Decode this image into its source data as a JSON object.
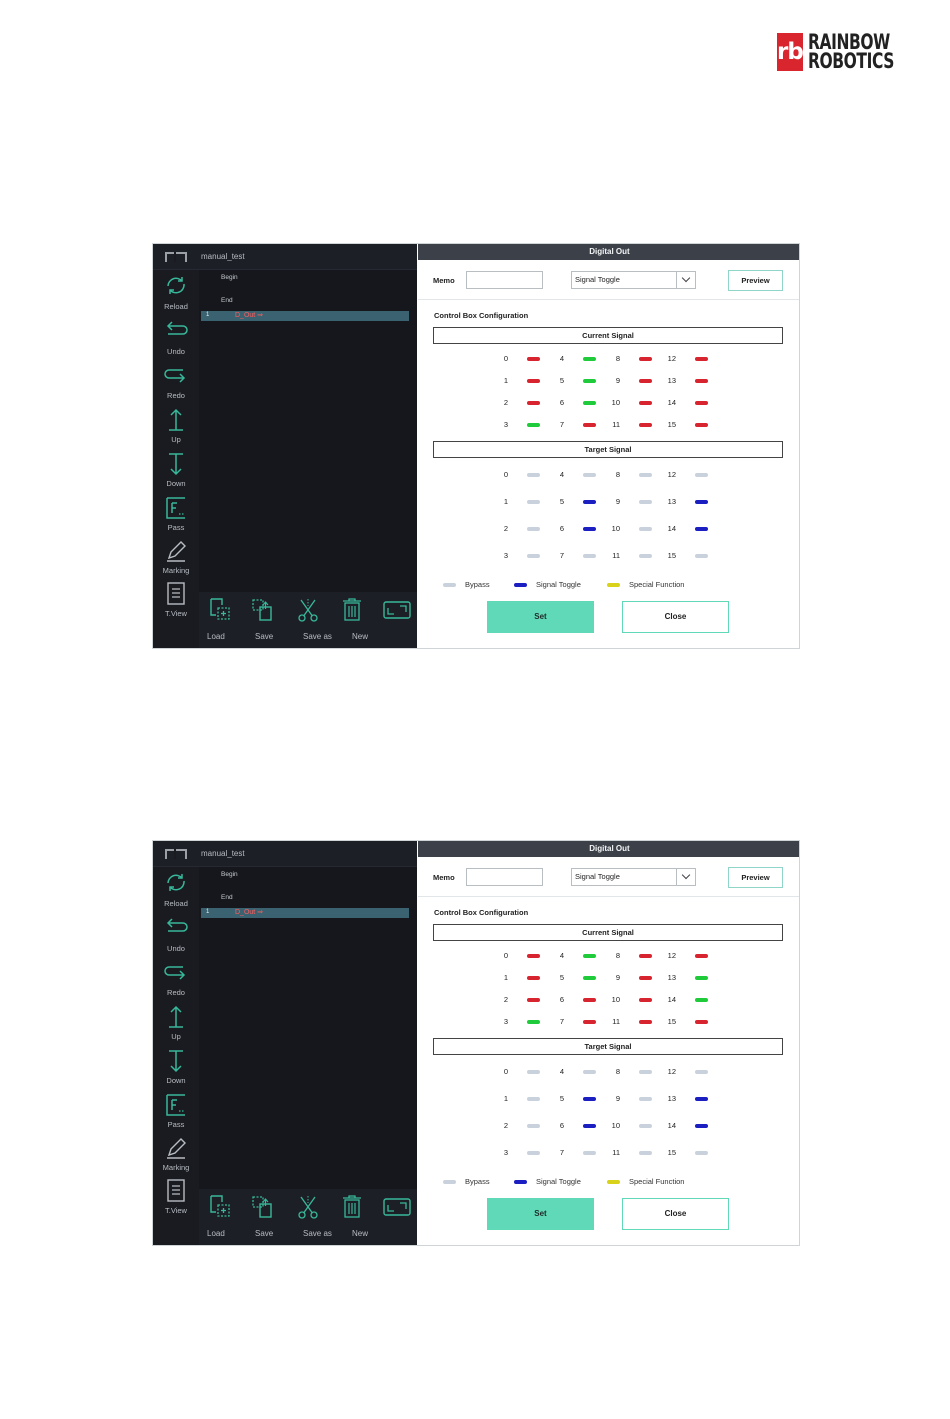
{
  "brand": {
    "mark": "rb",
    "line1": "RAINBOW",
    "line2": "ROBOTICS"
  },
  "colors": {
    "signal_red": "#d8242f",
    "signal_green": "#1fcb3a",
    "bypass": "#c9d2dc",
    "signal_toggle": "#1b1fc2",
    "special_function": "#d8d21a",
    "accent": "#5fd9b8",
    "editor_bg": "#191b21"
  },
  "screenshots": [
    {
      "editor": {
        "file_name": "manual_test",
        "code_lines": [
          "Begin",
          "End"
        ],
        "selected_line_number": "1",
        "selected_command": "D_Out  ⇒",
        "toolbar": [
          {
            "label": "Reload",
            "icon": "reload-icon"
          },
          {
            "label": "Undo",
            "icon": "undo-icon"
          },
          {
            "label": "Redo",
            "icon": "redo-icon"
          },
          {
            "label": "Up",
            "icon": "up-arrow-icon"
          },
          {
            "label": "Down",
            "icon": "down-arrow-icon"
          },
          {
            "label": "Pass",
            "icon": "pass-icon"
          },
          {
            "label": "Marking",
            "icon": "marking-pen-icon"
          },
          {
            "label": "T.View",
            "icon": "text-view-icon"
          }
        ],
        "bottom_actions": [
          "Load",
          "Save",
          "Save as",
          "New"
        ]
      },
      "dialog": {
        "title": "Digital Out",
        "memo_label": "Memo",
        "memo_value": "",
        "mode_selected": "Signal Toggle",
        "preview_label": "Preview",
        "config_title": "Control Box Configuration",
        "current_signal_title": "Current Signal",
        "target_signal_title": "Target Signal",
        "current_signal": {
          "0": "red",
          "1": "red",
          "2": "red",
          "3": "green",
          "4": "green",
          "5": "green",
          "6": "green",
          "7": "red",
          "8": "red",
          "9": "red",
          "10": "red",
          "11": "red",
          "12": "red",
          "13": "red",
          "14": "red",
          "15": "red"
        },
        "target_signal": {
          "0": "bypass",
          "1": "bypass",
          "2": "bypass",
          "3": "bypass",
          "4": "bypass",
          "5": "signal_toggle",
          "6": "signal_toggle",
          "7": "bypass",
          "8": "bypass",
          "9": "bypass",
          "10": "bypass",
          "11": "bypass",
          "12": "bypass",
          "13": "signal_toggle",
          "14": "signal_toggle",
          "15": "bypass"
        },
        "legend": [
          "Bypass",
          "Signal Toggle",
          "Special Function"
        ],
        "set_label": "Set",
        "close_label": "Close"
      }
    },
    {
      "editor": {
        "file_name": "manual_test",
        "code_lines": [
          "Begin",
          "End"
        ],
        "selected_line_number": "1",
        "selected_command": "D_Out  ⇒",
        "toolbar": [
          {
            "label": "Reload",
            "icon": "reload-icon"
          },
          {
            "label": "Undo",
            "icon": "undo-icon"
          },
          {
            "label": "Redo",
            "icon": "redo-icon"
          },
          {
            "label": "Up",
            "icon": "up-arrow-icon"
          },
          {
            "label": "Down",
            "icon": "down-arrow-icon"
          },
          {
            "label": "Pass",
            "icon": "pass-icon"
          },
          {
            "label": "Marking",
            "icon": "marking-pen-icon"
          },
          {
            "label": "T.View",
            "icon": "text-view-icon"
          }
        ],
        "bottom_actions": [
          "Load",
          "Save",
          "Save as",
          "New"
        ]
      },
      "dialog": {
        "title": "Digital Out",
        "memo_label": "Memo",
        "memo_value": "",
        "mode_selected": "Signal Toggle",
        "preview_label": "Preview",
        "config_title": "Control Box Configuration",
        "current_signal_title": "Current Signal",
        "target_signal_title": "Target Signal",
        "current_signal": {
          "0": "red",
          "1": "red",
          "2": "red",
          "3": "green",
          "4": "green",
          "5": "green",
          "6": "red",
          "7": "red",
          "8": "red",
          "9": "red",
          "10": "red",
          "11": "red",
          "12": "red",
          "13": "green",
          "14": "green",
          "15": "red"
        },
        "target_signal": {
          "0": "bypass",
          "1": "bypass",
          "2": "bypass",
          "3": "bypass",
          "4": "bypass",
          "5": "signal_toggle",
          "6": "signal_toggle",
          "7": "bypass",
          "8": "bypass",
          "9": "bypass",
          "10": "bypass",
          "11": "bypass",
          "12": "bypass",
          "13": "signal_toggle",
          "14": "signal_toggle",
          "15": "bypass"
        },
        "legend": [
          "Bypass",
          "Signal Toggle",
          "Special Function"
        ],
        "set_label": "Set",
        "close_label": "Close"
      }
    }
  ]
}
